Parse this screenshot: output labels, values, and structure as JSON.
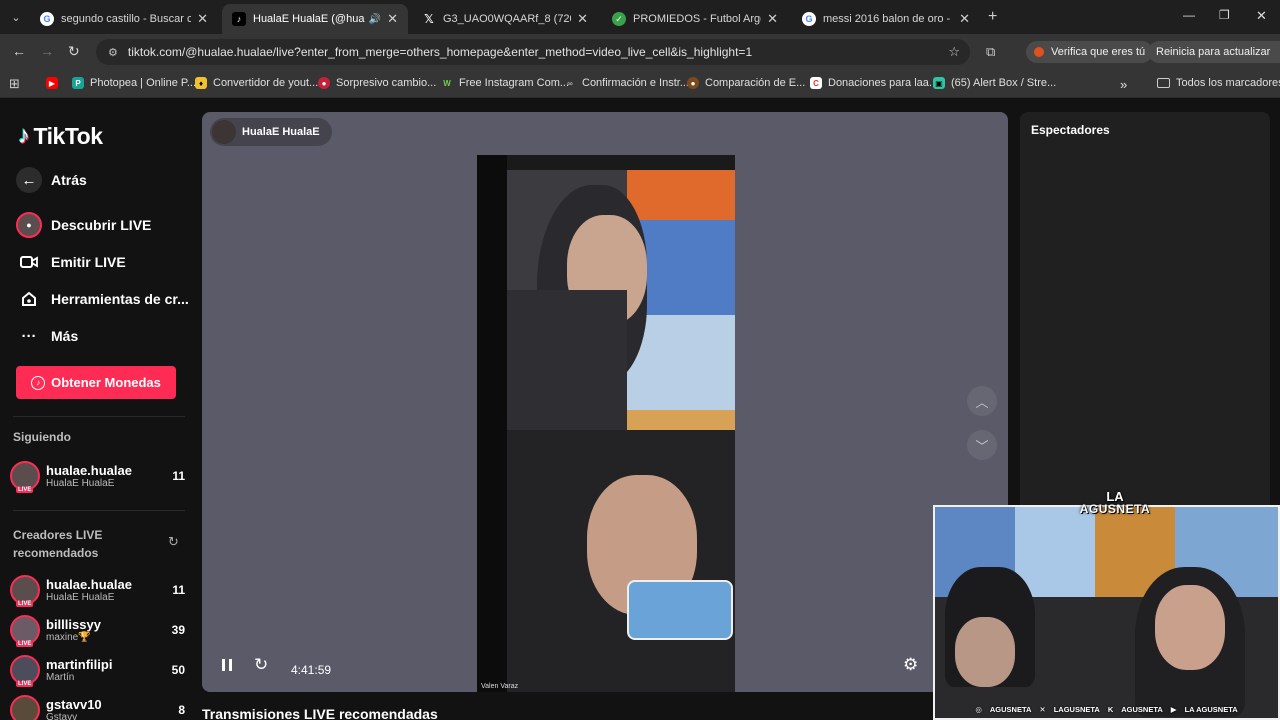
{
  "browser": {
    "tabs": [
      {
        "title": "segundo castillo - Buscar con G",
        "favicon": "google-icon",
        "active": false
      },
      {
        "title": "HualaE HualaE (@hualae.hu",
        "favicon": "tiktok-icon",
        "active": true
      },
      {
        "title": "G3_UAO0WQAARf_8 (720×120",
        "favicon": "x-icon",
        "active": false
      },
      {
        "title": "PROMIEDOS - Futbol Argentino",
        "favicon": "promiedos-icon",
        "active": false
      },
      {
        "title": "messi 2016 balon de oro - Busc",
        "favicon": "google-icon",
        "active": false
      }
    ],
    "url": "tiktok.com/@hualae.hualae/live?enter_from_merge=others_homepage&enter_method=video_live_cell&is_highlight=1",
    "verify_label": "Verifica que eres tú",
    "update_label": "Reinicia para actualizar",
    "bookmarks": [
      {
        "label": "",
        "favicon": "youtube-icon"
      },
      {
        "label": "Photopea | Online P...",
        "favicon": "photopea-icon"
      },
      {
        "label": "Convertidor de yout...",
        "favicon": "converter-icon"
      },
      {
        "label": "Sorpresivo cambio...",
        "favicon": "news-icon"
      },
      {
        "label": "Free Instagram Com...",
        "favicon": "w-icon"
      },
      {
        "label": "Confirmación e Instr...",
        "favicon": "link-icon"
      },
      {
        "label": "Comparación de E...",
        "favicon": "compare-icon"
      },
      {
        "label": "Donaciones para laa...",
        "favicon": "donation-icon"
      },
      {
        "label": "(65) Alert Box / Stre...",
        "favicon": "alertbox-icon"
      }
    ],
    "all_bookmarks_label": "Todos los marcadores"
  },
  "sidebar": {
    "logo": "TikTok",
    "back": "Atrás",
    "nav": [
      {
        "label": "Descubrir LIVE",
        "icon": "live-avatar-icon"
      },
      {
        "label": "Emitir LIVE",
        "icon": "video-camera-icon"
      },
      {
        "label": "Herramientas de cr...",
        "icon": "home-tools-icon"
      },
      {
        "label": "Más",
        "icon": "more-dots-icon"
      }
    ],
    "coins_button": "Obtener Monedas",
    "following_title": "Siguiendo",
    "following": [
      {
        "name": "hualae.hualae",
        "sub": "HualaE HualaE",
        "count": "11"
      }
    ],
    "creators_title": "Creadores LIVE recomendados",
    "creators": [
      {
        "name": "hualae.hualae",
        "sub": "HualaE HualaE",
        "count": "11"
      },
      {
        "name": "billlissyy",
        "sub": "maxine🏆",
        "count": "39"
      },
      {
        "name": "martinfilipi",
        "sub": "Martín",
        "count": "50"
      },
      {
        "name": "gstavv10",
        "sub": "Gstavv",
        "count": "8"
      }
    ]
  },
  "player": {
    "host_name": "HualaE HualaE",
    "timer": "4:41:59",
    "video_caption": "Valen Varaz"
  },
  "viewers": {
    "title": "Espectadores"
  },
  "recommended_title": "Transmisiones LIVE recomendadas",
  "webcam": {
    "banner_line1": "LA",
    "banner_line2": "AGUSNETA",
    "socials": [
      "AGUSNETA",
      "LAGUSNETA",
      "AGUSNETA",
      "LA AGUSNETA"
    ]
  },
  "colors": {
    "brand_pink": "#fe2c55",
    "player_bg": "#5b5a68",
    "page_bg": "#121212"
  }
}
